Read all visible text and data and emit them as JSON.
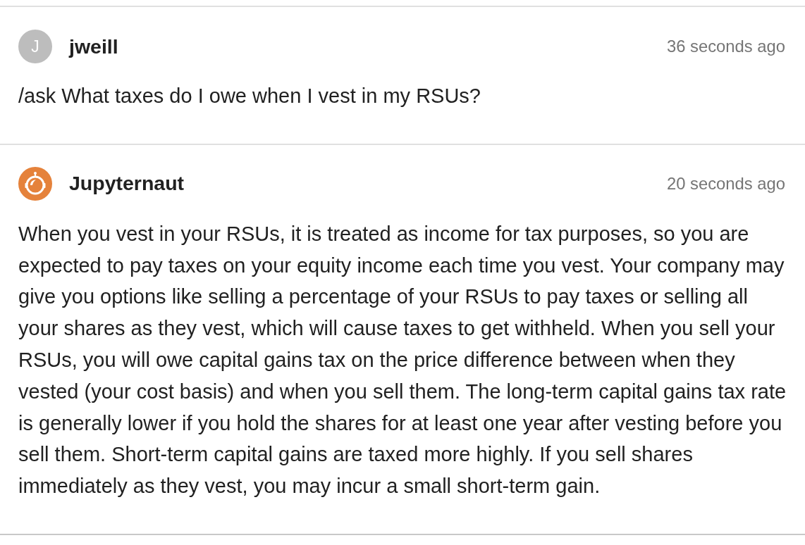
{
  "messages": [
    {
      "sender": {
        "name": "jweill",
        "kind": "human",
        "avatar_letter": "J"
      },
      "timestamp": "36 seconds ago",
      "body": "/ask What taxes do I owe when I vest in my RSUs?"
    },
    {
      "sender": {
        "name": "Jupyternaut",
        "kind": "bot"
      },
      "timestamp": "20 seconds ago",
      "body": "When you vest in your RSUs, it is treated as income for tax purposes, so you are expected to pay taxes on your equity income each time you vest. Your company may give you options like selling a percentage of your RSUs to pay taxes or selling all your shares as they vest, which will cause taxes to get withheld. When you sell your RSUs, you will owe capital gains tax on the price difference between when they vested (your cost basis) and when you sell them. The long-term capital gains tax rate is generally lower if you hold the shares for at least one year after vesting before you sell them. Short-term capital gains are taxed more highly. If you sell shares immediately as they vest, you may incur a small short-term gain."
    }
  ]
}
